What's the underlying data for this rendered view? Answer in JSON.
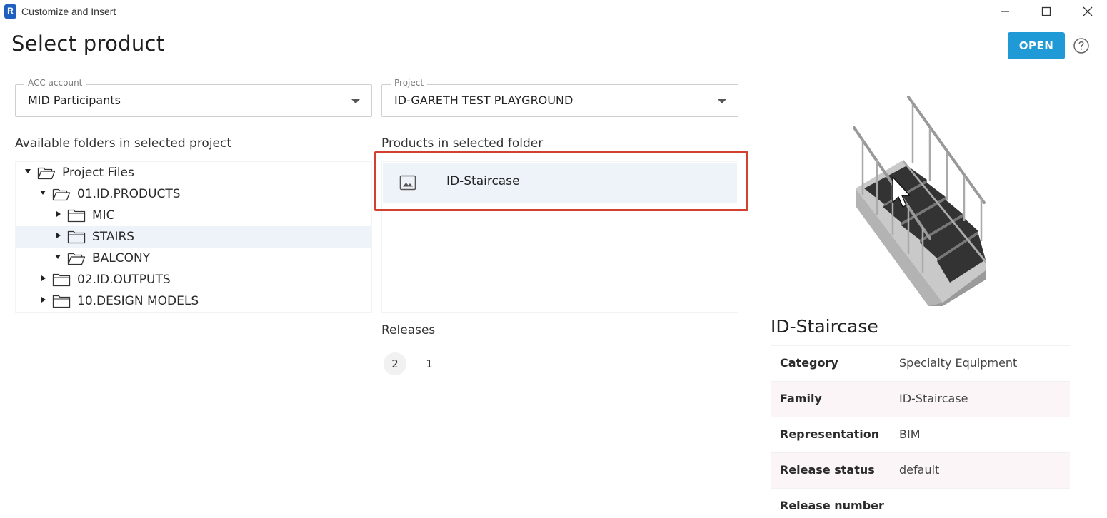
{
  "window": {
    "app_icon_letter": "R",
    "title": "Customize and Insert"
  },
  "header": {
    "title": "Select product",
    "open_label": "OPEN"
  },
  "acc_account": {
    "label": "ACC account",
    "value": "MID Participants"
  },
  "project": {
    "label": "Project",
    "value": "ID-GARETH TEST PLAYGROUND"
  },
  "folders": {
    "heading": "Available folders in selected project",
    "items": [
      {
        "label": "Project Files",
        "expanded": true,
        "selected": false
      },
      {
        "label": "01.ID.PRODUCTS",
        "expanded": true,
        "selected": false
      },
      {
        "label": "MIC",
        "expanded": false,
        "selected": false
      },
      {
        "label": "STAIRS",
        "expanded": false,
        "selected": true
      },
      {
        "label": "BALCONY",
        "expanded": true,
        "selected": false
      },
      {
        "label": "02.ID.OUTPUTS",
        "expanded": false,
        "selected": false
      },
      {
        "label": "10.DESIGN MODELS",
        "expanded": false,
        "selected": false
      }
    ]
  },
  "products": {
    "heading": "Products in selected folder",
    "items": [
      {
        "name": "ID-Staircase",
        "thumbnail_icon": "image-icon"
      }
    ]
  },
  "releases": {
    "heading": "Releases",
    "items": [
      "2",
      "1"
    ],
    "selected": "2"
  },
  "details": {
    "title": "ID-Staircase",
    "rows": [
      {
        "key": "Category",
        "value": "Specialty Equipment"
      },
      {
        "key": "Family",
        "value": "ID-Staircase"
      },
      {
        "key": "Representation",
        "value": "BIM"
      },
      {
        "key": "Release status",
        "value": "default"
      },
      {
        "key": "Release number",
        "value": ""
      }
    ]
  },
  "colors": {
    "accent": "#1f9ad6",
    "highlight": "#d2412f",
    "selection": "#eef3fa"
  }
}
